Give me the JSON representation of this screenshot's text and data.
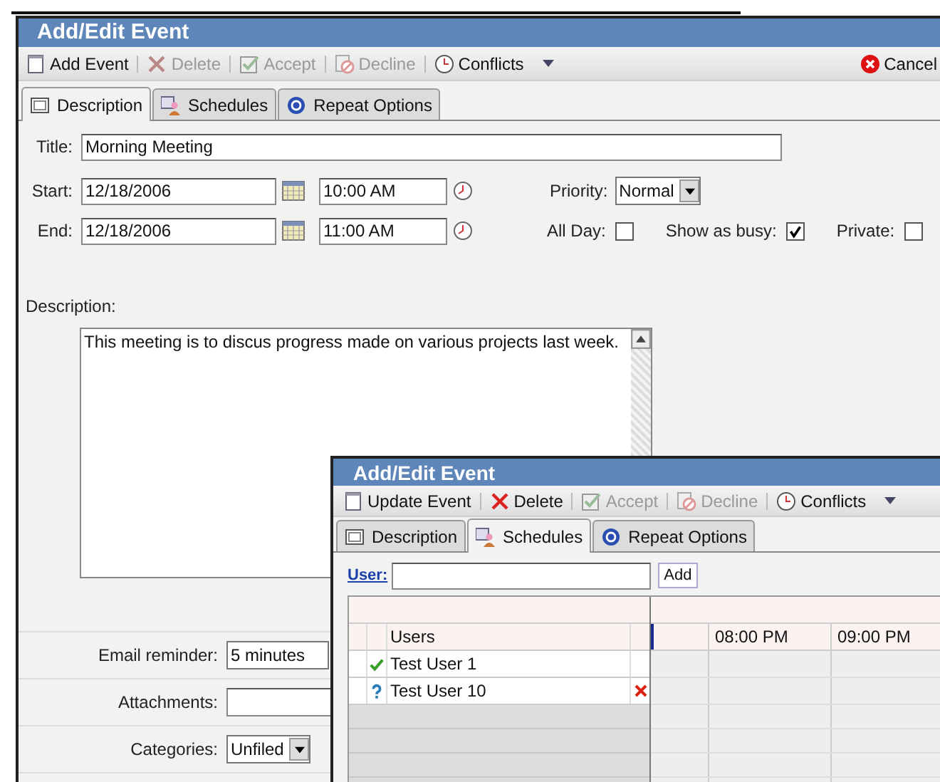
{
  "back_window": {
    "title": "Add/Edit Event",
    "toolbar": [
      {
        "label": "Add Event",
        "kind": "page",
        "disabled": false
      },
      {
        "label": "Delete",
        "kind": "cross",
        "disabled": true
      },
      {
        "label": "Accept",
        "kind": "check",
        "disabled": true
      },
      {
        "label": "Decline",
        "kind": "no",
        "disabled": true
      },
      {
        "label": "Conflicts",
        "kind": "clock",
        "disabled": false,
        "dropdown": true
      }
    ],
    "cancel": "Cancel",
    "tabs": [
      {
        "label": "Description",
        "kind": "page",
        "selected": true
      },
      {
        "label": "Schedules",
        "kind": "people",
        "selected": false
      },
      {
        "label": "Repeat Options",
        "kind": "repeat",
        "selected": false
      }
    ],
    "title_label": "Title:",
    "title_value": "Morning Meeting",
    "start_label": "Start:",
    "start_date": "12/18/2006",
    "start_time": "10:00 AM",
    "end_label": "End:",
    "end_date": "12/18/2006",
    "end_time": "11:00 AM",
    "priority_label": "Priority:",
    "priority": "Normal",
    "checks": [
      {
        "label": "All Day:",
        "checked": false
      },
      {
        "label": "Show as busy:",
        "checked": true
      },
      {
        "label": "Private:",
        "checked": false
      }
    ],
    "description_label": "Description:",
    "description": "This meeting is to discus progress made on various projects last week.",
    "email_label": "Email reminder:",
    "email_value": "5 minutes",
    "attachments_label": "Attachments:",
    "categories_label": "Categories:",
    "categories_value": "Unfiled"
  },
  "front_window": {
    "title": "Add/Edit Event",
    "toolbar": [
      {
        "label": "Update Event",
        "kind": "page",
        "disabled": false
      },
      {
        "label": "Delete",
        "kind": "cross",
        "disabled": false
      },
      {
        "label": "Accept",
        "kind": "check",
        "disabled": true
      },
      {
        "label": "Decline",
        "kind": "no",
        "disabled": true
      },
      {
        "label": "Conflicts",
        "kind": "clock",
        "disabled": false,
        "dropdown": true
      }
    ],
    "tabs": [
      {
        "label": "Description",
        "kind": "page",
        "selected": false
      },
      {
        "label": "Schedules",
        "kind": "people",
        "selected": true
      },
      {
        "label": "Repeat Options",
        "kind": "repeat",
        "selected": false
      }
    ],
    "user_label": "User:",
    "add_button": "Add",
    "users_header": "Users",
    "time_columns": [
      "08:00 PM",
      "09:00 PM"
    ],
    "users": [
      {
        "name": "Test User 1",
        "kind": "accepted",
        "removable": false
      },
      {
        "name": "Test User 10",
        "kind": "unknown",
        "removable": true
      }
    ]
  }
}
